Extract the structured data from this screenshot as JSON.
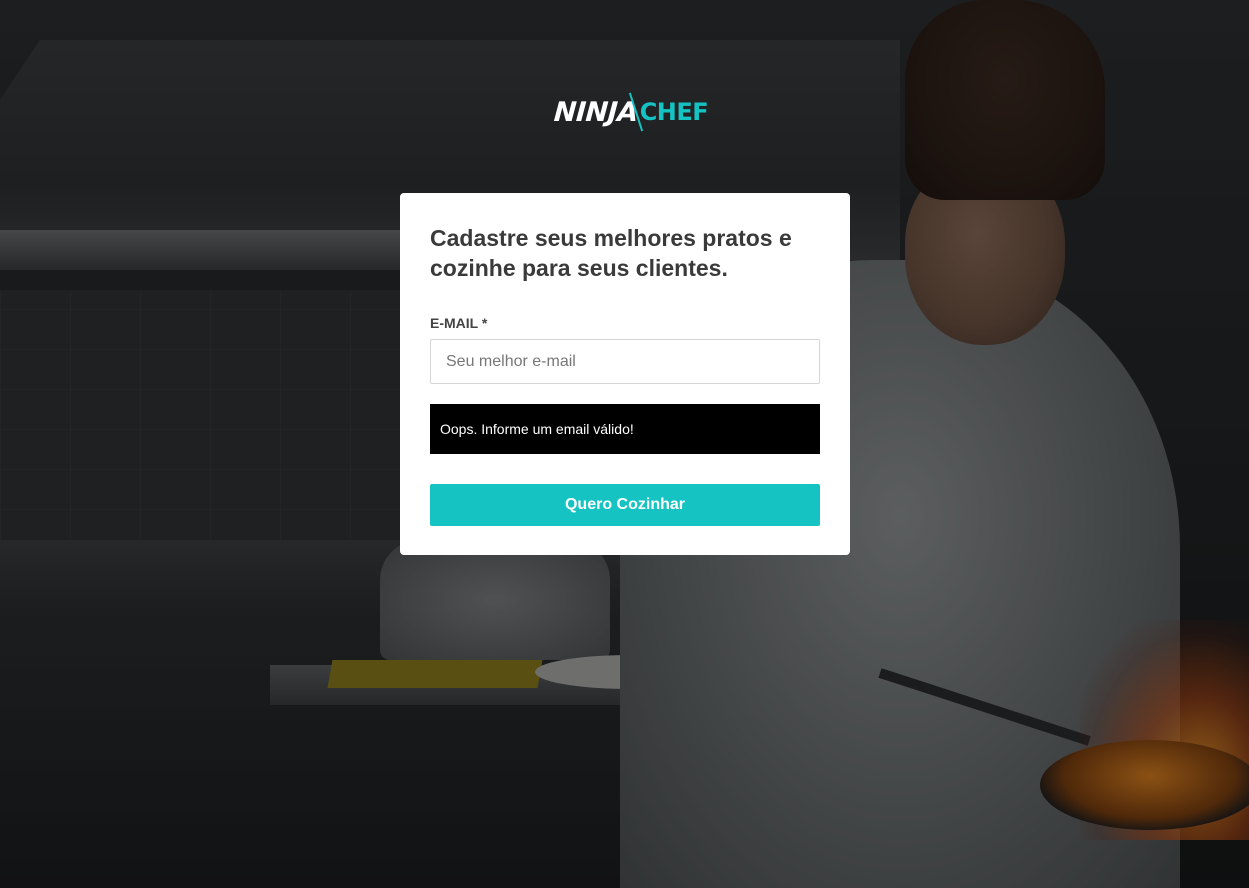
{
  "brand": {
    "logo_text_primary": "NINJA",
    "logo_text_accent": "CHEF",
    "accent_color": "#15c3c3"
  },
  "signup_card": {
    "heading": "Cadastre seus melhores pratos e cozinhe para seus clientes.",
    "email_label": "E-MAIL *",
    "email_placeholder": "Seu melhor e-mail",
    "email_value": "",
    "error_message": "Oops. Informe um email válido!",
    "submit_label": "Quero Cozinhar"
  },
  "background": {
    "icon": "kitchen-chef-photo"
  }
}
